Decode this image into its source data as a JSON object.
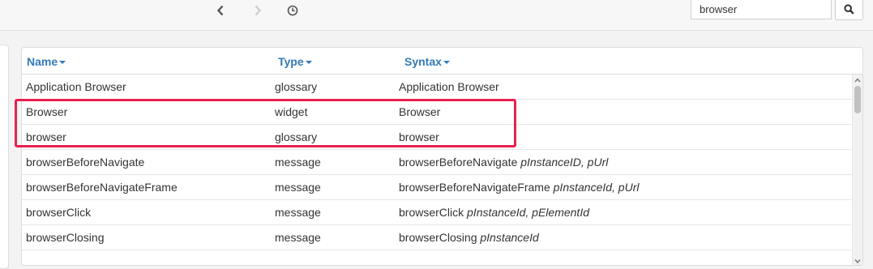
{
  "search": {
    "value": "browser"
  },
  "table": {
    "columns": [
      "Name",
      "Type",
      "Syntax"
    ],
    "rows": [
      {
        "name": "Application Browser",
        "type": "glossary",
        "syntax": "Application Browser",
        "params": ""
      },
      {
        "name": "Browser",
        "type": "widget",
        "syntax": "Browser",
        "params": ""
      },
      {
        "name": "browser",
        "type": "glossary",
        "syntax": "browser",
        "params": ""
      },
      {
        "name": "browserBeforeNavigate",
        "type": "message",
        "syntax": "browserBeforeNavigate",
        "params": "pInstanceID, pUrl"
      },
      {
        "name": "browserBeforeNavigateFrame",
        "type": "message",
        "syntax": "browserBeforeNavigateFrame",
        "params": "pInstanceId, pUrl"
      },
      {
        "name": "browserClick",
        "type": "message",
        "syntax": "browserClick",
        "params": "pInstanceId, pElementId"
      },
      {
        "name": "browserClosing",
        "type": "message",
        "syntax": "browserClosing",
        "params": "pInstanceId"
      }
    ]
  },
  "icons": {
    "back": "chevron-left-icon",
    "forward": "chevron-right-icon",
    "history": "clock-icon",
    "search": "search-icon"
  },
  "colors": {
    "link": "#337ab7",
    "highlight": "#e8214f"
  }
}
